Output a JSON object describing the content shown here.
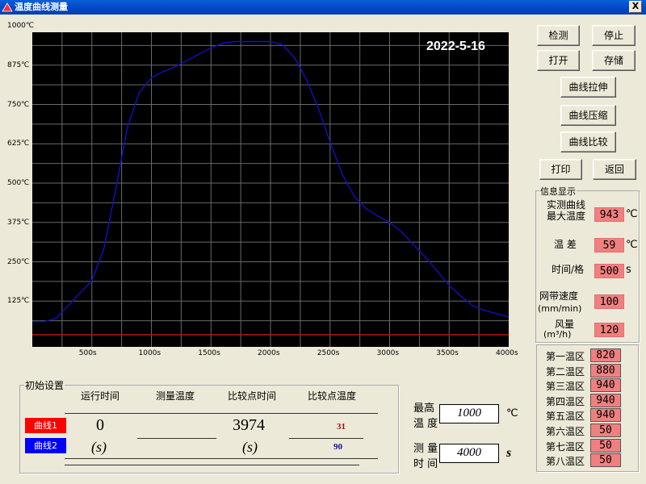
{
  "window": {
    "title": "温度曲线测量",
    "close": "X"
  },
  "chart": {
    "date": "2022-5-16",
    "y_ticks": [
      "1000℃",
      "875℃",
      "750℃",
      "625℃",
      "500℃",
      "375℃",
      "250℃",
      "125℃"
    ],
    "x_ticks": [
      "500s",
      "1000s",
      "1500s",
      "2000s",
      "2500s",
      "3000s",
      "3500s",
      "4000s"
    ]
  },
  "chart_data": {
    "type": "line",
    "xlim": [
      0,
      4000
    ],
    "ylim": [
      0,
      1000
    ],
    "grid": true,
    "series": [
      {
        "color": "#1010c0",
        "x": [
          0,
          100,
          200,
          300,
          400,
          500,
          600,
          700,
          800,
          900,
          1000,
          1100,
          1200,
          1300,
          1400,
          1500,
          1600,
          1700,
          1800,
          1900,
          2000,
          2100,
          2200,
          2300,
          2400,
          2500,
          2600,
          2700,
          2800,
          2900,
          3000,
          3100,
          3200,
          3300,
          3400,
          3500,
          3600,
          3700,
          3800,
          3900,
          4000
        ],
        "y": [
          60,
          60,
          70,
          110,
          150,
          190,
          290,
          480,
          680,
          790,
          835,
          855,
          870,
          890,
          910,
          930,
          945,
          950,
          950,
          950,
          950,
          940,
          900,
          830,
          740,
          630,
          530,
          460,
          420,
          395,
          375,
          345,
          305,
          265,
          220,
          175,
          140,
          110,
          95,
          85,
          75
        ]
      },
      {
        "color": "#c01010",
        "x": [
          0,
          500,
          1000,
          1500,
          2000,
          2500,
          3000,
          3500,
          4000
        ],
        "y": [
          18,
          18,
          18,
          18,
          18,
          18,
          18,
          18,
          18
        ]
      }
    ]
  },
  "buttons": {
    "detect": "检测",
    "stop": "停止",
    "open": "打开",
    "save": "存储",
    "stretch": "曲线拉伸",
    "compress": "曲线压缩",
    "compare": "曲线比较",
    "print": "打印",
    "back": "返回"
  },
  "info": {
    "legend": "信息显示",
    "max_temp_label_1": "实测曲线",
    "max_temp_label_2": "最大温度",
    "max_temp_value": "943",
    "max_temp_unit": "℃",
    "diff_label": "温  差",
    "diff_value": "59",
    "diff_unit": "℃",
    "time_grid_label": "时间/格",
    "time_grid_value": "500",
    "time_grid_unit": "s",
    "belt_label_1": "网带速度",
    "belt_label_2": "(mm/min)",
    "belt_value": "100",
    "wind_label_1": "风量",
    "wind_label_2": "(m³/h)",
    "wind_value": "120"
  },
  "zones": [
    {
      "label": "第一温区",
      "value": "820"
    },
    {
      "label": "第二温区",
      "value": "880"
    },
    {
      "label": "第三温区",
      "value": "940"
    },
    {
      "label": "第四温区",
      "value": "940"
    },
    {
      "label": "第五温区",
      "value": "940"
    },
    {
      "label": "第六温区",
      "value": "50"
    },
    {
      "label": "第七温区",
      "value": "50"
    },
    {
      "label": "第八温区",
      "value": "50"
    }
  ],
  "init": {
    "legend": "初始设置",
    "col_run_time": "运行时间",
    "col_measure_temp": "测量温度",
    "col_cmp_time": "比较点时间",
    "col_cmp_temp": "比较点温度",
    "curve1_label": "曲线1",
    "curve2_label": "曲线2",
    "run_time_value": "0",
    "run_time_unit": "(s)",
    "cmp_time_value": "3974",
    "cmp_time_unit": "(s)",
    "cmp_temp_1": "31",
    "cmp_temp_2": "90",
    "max_temp_label_1": "最高",
    "max_temp_label_2": "温 度",
    "max_temp_value": "1000",
    "max_temp_unit": "℃",
    "measure_time_label_1": "测 量",
    "measure_time_label_2": "时 间",
    "measure_time_value": "4000",
    "measure_time_unit": "s"
  },
  "colors": {
    "curve1": "#ff0000",
    "curve2": "#0000ff",
    "value_box": "#f08080"
  }
}
